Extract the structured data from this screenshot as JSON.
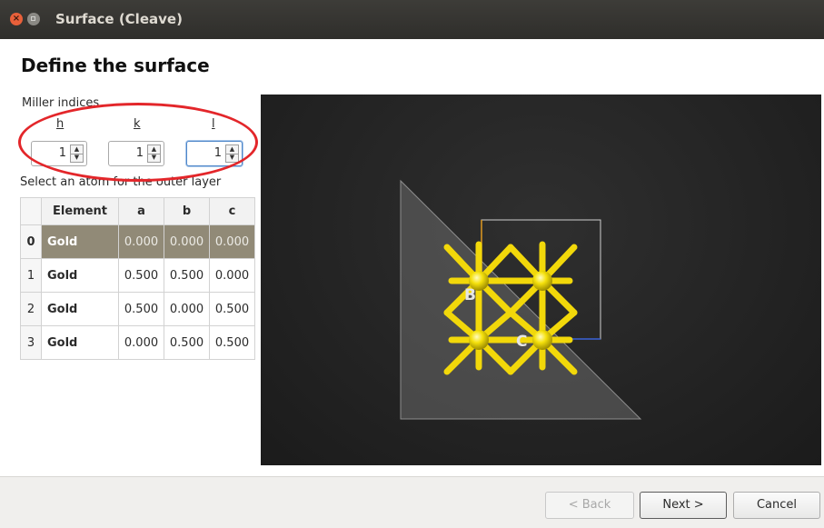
{
  "window": {
    "title": "Surface (Cleave)",
    "close_glyph": "×"
  },
  "page": {
    "heading": "Define the surface"
  },
  "miller": {
    "label": "Miller indices",
    "h": {
      "label": "h",
      "value": "1"
    },
    "k": {
      "label": "k",
      "value": "1"
    },
    "l": {
      "label": "l",
      "value": "1"
    },
    "spin_up": "▲",
    "spin_down": "▼"
  },
  "atoms": {
    "label": "Select an atom for the outer layer",
    "columns": [
      "Element",
      "a",
      "b",
      "c"
    ],
    "rows": [
      {
        "index": "0",
        "element": "Gold",
        "a": "0.000",
        "b": "0.000",
        "c": "0.000",
        "selected": true
      },
      {
        "index": "1",
        "element": "Gold",
        "a": "0.500",
        "b": "0.500",
        "c": "0.000"
      },
      {
        "index": "2",
        "element": "Gold",
        "a": "0.500",
        "b": "0.000",
        "c": "0.500"
      },
      {
        "index": "3",
        "element": "Gold",
        "a": "0.000",
        "b": "0.500",
        "c": "0.500"
      }
    ]
  },
  "viewer": {
    "axis_labels": {
      "b": "B",
      "c": "C"
    },
    "atom_color": "#f5e10c",
    "background": "#232323"
  },
  "buttons": {
    "back": "< Back",
    "next": "Next >",
    "cancel": "Cancel"
  },
  "annotation": {
    "ellipse_color": "#e3262a"
  }
}
